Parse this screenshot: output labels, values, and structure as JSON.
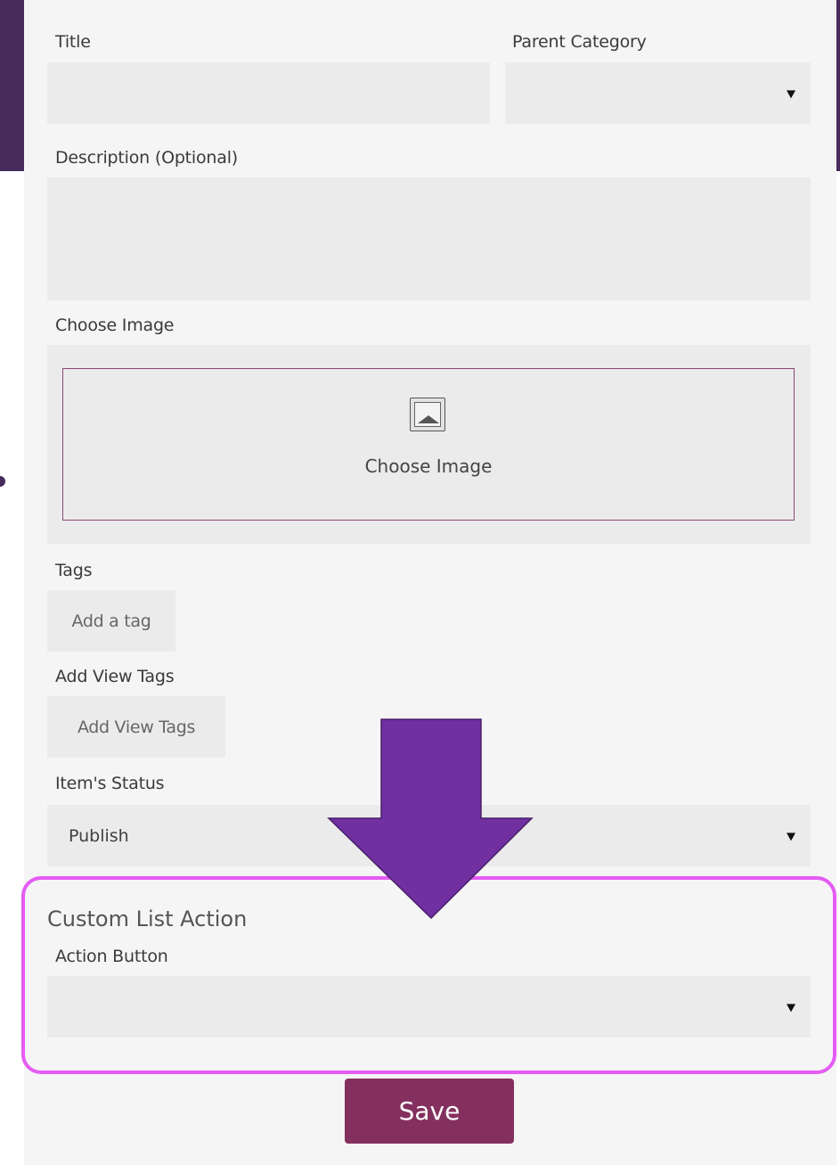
{
  "form": {
    "title_label": "Title",
    "title_value": "",
    "parent_category_label": "Parent Category",
    "parent_category_value": "",
    "description_label": "Description (Optional)",
    "description_value": "",
    "choose_image_label": "Choose Image",
    "choose_image_button": "Choose Image",
    "tags_label": "Tags",
    "tags_placeholder": "Add a tag",
    "view_tags_label": "Add View Tags",
    "view_tags_placeholder": "Add View Tags",
    "status_label": "Item's Status",
    "status_value": "Publish"
  },
  "custom_list_action": {
    "heading": "Custom List Action",
    "action_button_label": "Action Button",
    "action_button_value": ""
  },
  "save_label": "Save",
  "colors": {
    "brand": "#84305f",
    "header_band": "#472b5c",
    "highlight_border": "#e55cf3",
    "arrow_fill": "#7030a0"
  },
  "icons": {
    "image": "image-icon",
    "dropdown": "caret-down-icon",
    "annotation": "down-arrow-icon"
  }
}
